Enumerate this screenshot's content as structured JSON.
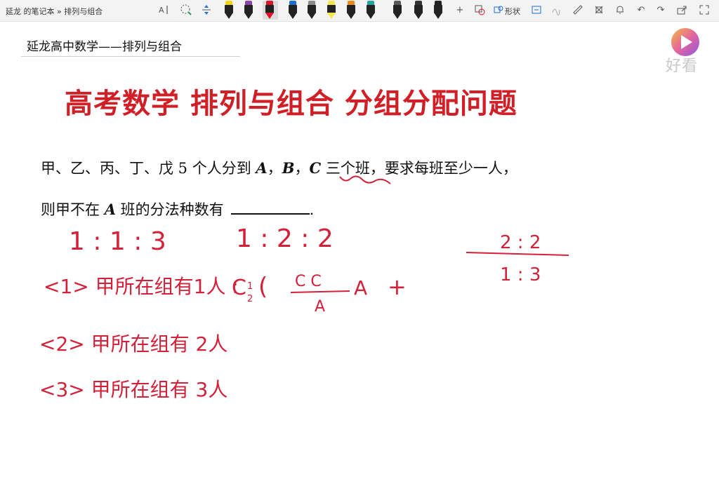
{
  "breadcrumb": "延龙 的笔记本 » 排列与组合",
  "toolbar": {
    "shape_label": "形状",
    "pen_colors": [
      "#f4d40c",
      "#8e44ad",
      "#e0102a",
      "#1e6fd0",
      "#8a8a8a",
      "#f6e84a",
      "#ef8b1c",
      "#1fa6a0",
      "#5a5a5a",
      "#333333",
      "#222222"
    ]
  },
  "page": {
    "title": "延龙高中数学——排列与组合",
    "headline": "高考数学 排列与组合 分组分配问题",
    "problem_line1_a": "甲、乙、丙、丁、戊 5 个人分到 ",
    "var_a": "A",
    "comma1": "，",
    "var_b": "B",
    "comma2": "，",
    "var_c": "C",
    "problem_line1_b": " 三个班，要求每班至少一人，",
    "problem_line2_a": "则甲不在 ",
    "problem_line2_b": " 班的分法种数有",
    "problem_end": "."
  },
  "handwriting": {
    "ratio1": "1 : 1 : 3",
    "ratio2": "1 : 2 : 2",
    "ratio3_top": "2 : 2",
    "ratio3_bottom": "1 : 3",
    "case1": "<1> 甲所在组有1人 :",
    "case1_formula_c": "C",
    "case1_formula_num": "C C",
    "case1_formula_den": "A",
    "case1_formula_tail": "A",
    "case2": "<2> 甲所在组有 2人",
    "case3": "<3> 甲所在组有 3人"
  },
  "watermark": {
    "brand": "好看",
    "color": "#d8d8d8"
  },
  "colors": {
    "headline": "#d01f26",
    "ink": "#d4213a",
    "toolbar_bg": "#f3f3f3"
  }
}
